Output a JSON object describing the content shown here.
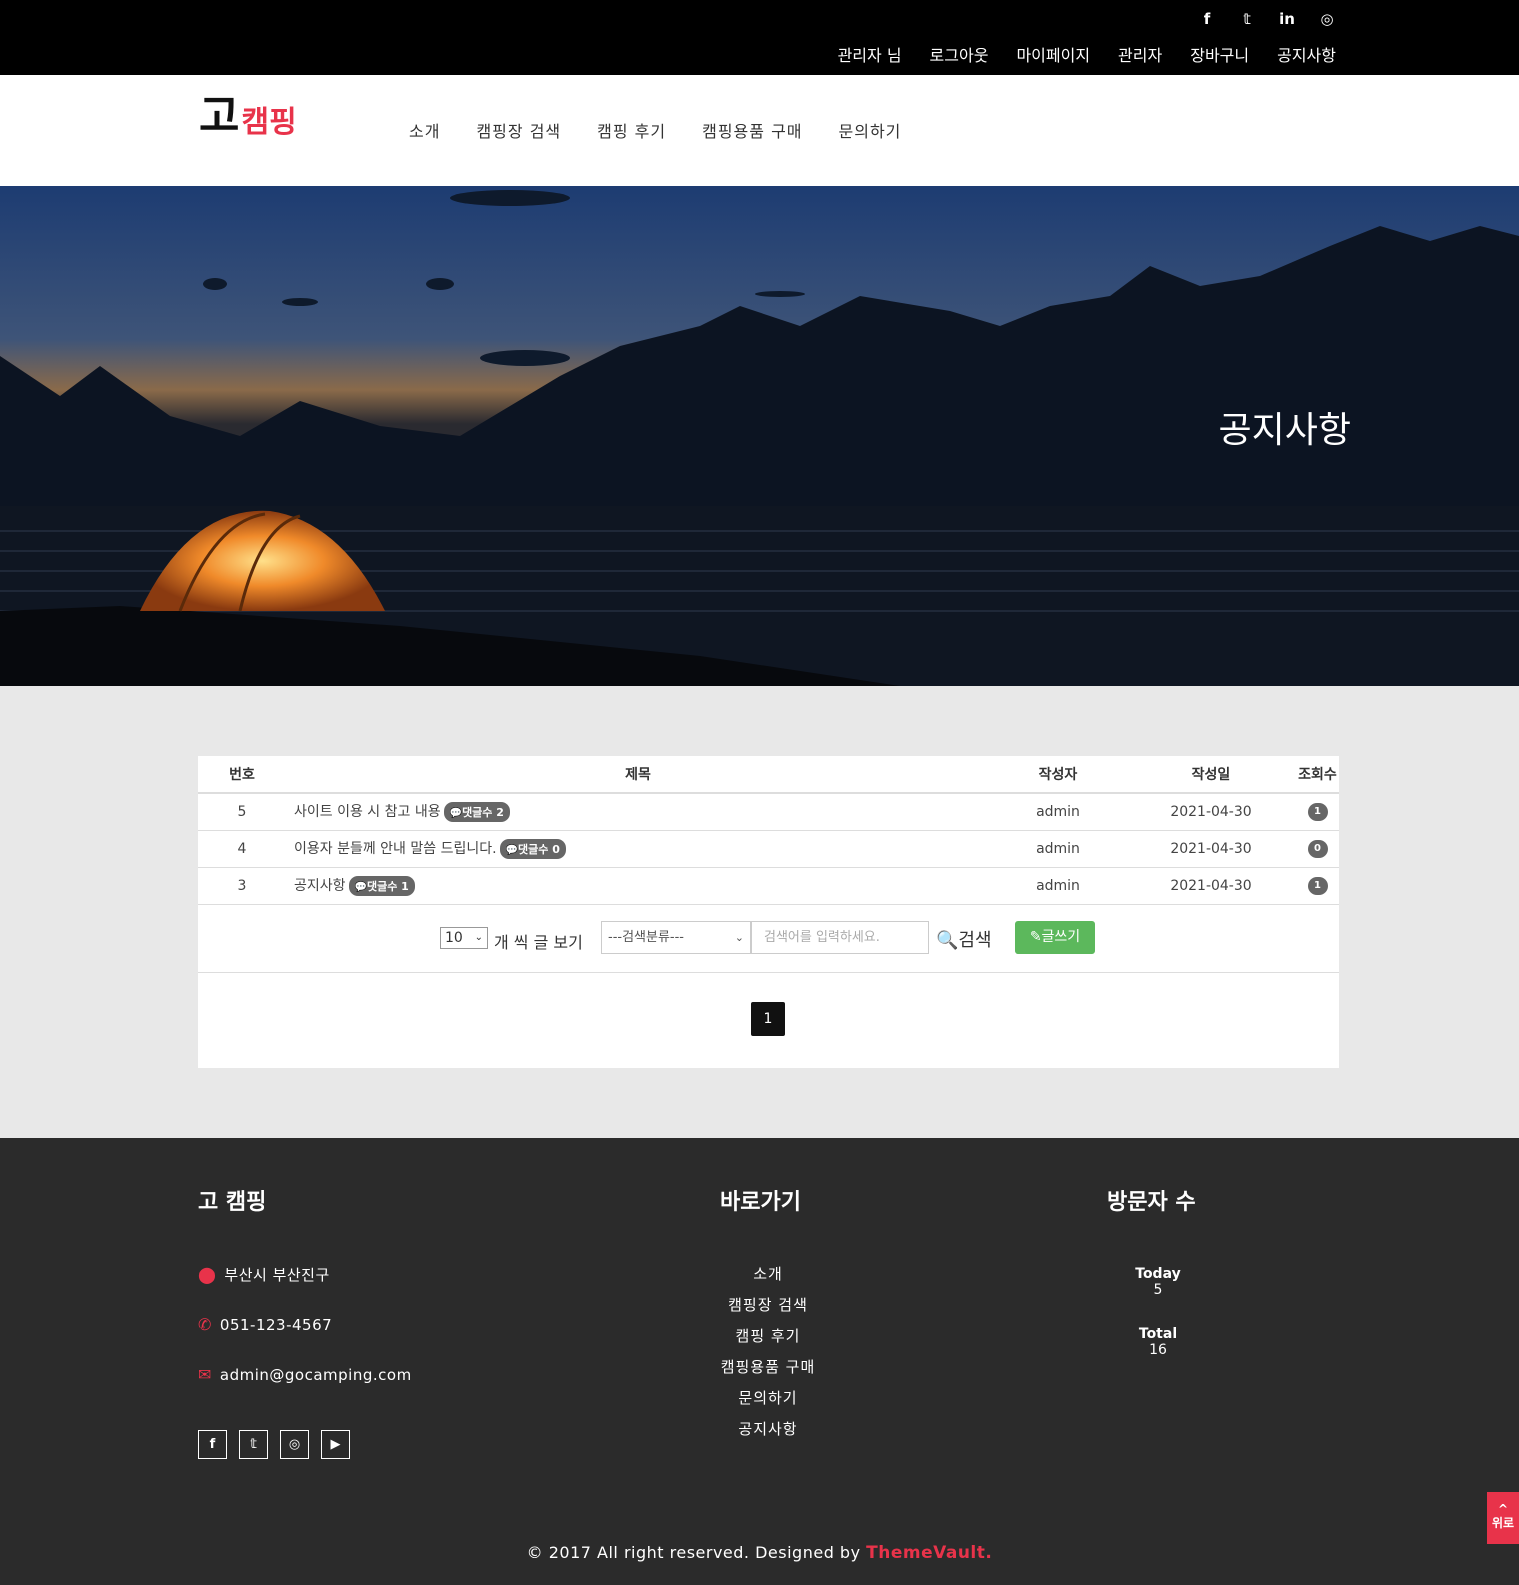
{
  "topbar": {
    "social": [
      "f",
      "𝕥",
      "in",
      "◎"
    ],
    "links": [
      "관리자 님",
      "로그아웃",
      "마이페이지",
      "관리자",
      "장바구니",
      "공지사항"
    ]
  },
  "header": {
    "logo_main": "고",
    "logo_sub": "캠핑",
    "nav": [
      "소개",
      "캠핑장 검색",
      "캠핑 후기",
      "캠핑용품 구매",
      "문의하기"
    ]
  },
  "hero": {
    "title": "공지사항"
  },
  "board": {
    "columns": [
      "번호",
      "제목",
      "작성자",
      "작성일",
      "조회수"
    ],
    "rows": [
      {
        "no": "5",
        "title": "사이트 이용 시 참고 내용",
        "comments": "댓글수 2",
        "author": "admin",
        "date": "2021-04-30",
        "views": "1"
      },
      {
        "no": "4",
        "title": "이용자 분들께 안내 말씀 드립니다.",
        "comments": "댓글수 0",
        "author": "admin",
        "date": "2021-04-30",
        "views": "0"
      },
      {
        "no": "3",
        "title": "공지사항",
        "comments": "댓글수 1",
        "author": "admin",
        "date": "2021-04-30",
        "views": "1"
      }
    ],
    "page_size": "10",
    "page_size_label": "개 씩 글 보기",
    "category_select": "---검색분류---",
    "search_placeholder": "검색어를 입력하세요.",
    "search_label": "검색",
    "write_label": "글쓰기",
    "current_page": "1"
  },
  "footer": {
    "col1_title": "고 캠핑",
    "address": "부산시 부산진구",
    "phone": "051-123-4567",
    "email": "admin@gocamping.com",
    "social": [
      "f",
      "𝕥",
      "◎",
      "▶"
    ],
    "col2_title": "바로가기",
    "links": [
      "소개",
      "캠핑장 검색",
      "캠핑 후기",
      "캠핑용품 구매",
      "문의하기",
      "공지사항"
    ],
    "col3_title": "방문자 수",
    "today_label": "Today",
    "today_value": "5",
    "total_label": "Total",
    "total_value": "16",
    "copyright_prefix": "© 2017 All right reserved. Designed by",
    "brand": "ThemeVault."
  },
  "to_top_label": "위로",
  "colors": {
    "accent": "#e8334a",
    "write_button": "#5cb85c"
  }
}
